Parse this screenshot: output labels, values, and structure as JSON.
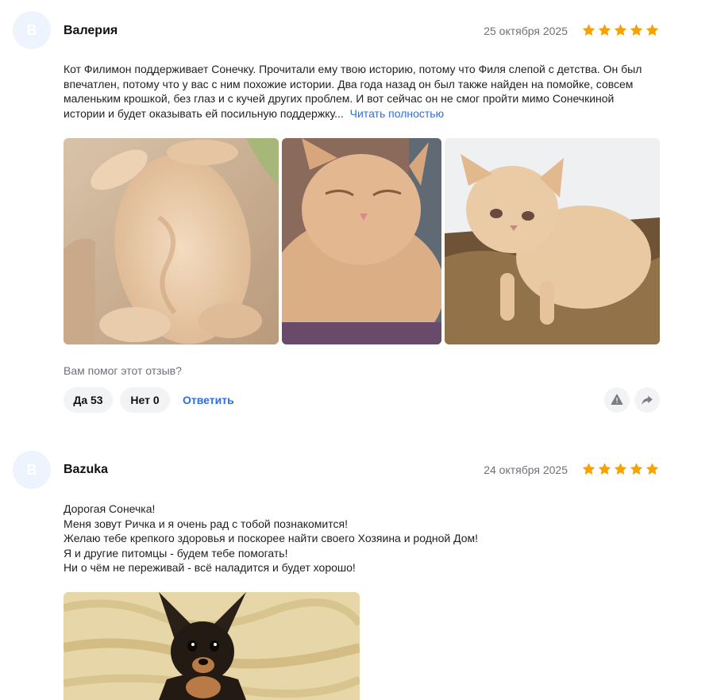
{
  "reviews": [
    {
      "avatar_letter": "B",
      "author": "Валерия",
      "date": "25 октября 2025",
      "rating": 5,
      "text": "Кот Филимон поддерживает Сонечку. Прочитали ему твою историю, потому что Филя слепой с детства. Он был впечатлен, потому что у вас с ним похожие истории. Два года назад он был также найден на помойке, совсем маленьким крошкой, без глаз и с кучей других проблем. И вот сейчас он не смог пройти мимо Сонечкиной истории и будет оказывать ей посильную поддержку...",
      "read_more": "Читать полностью",
      "helpful_question": "Вам помог этот отзыв?",
      "yes_label": "Да 53",
      "no_label": "Нет 0",
      "reply_label": "Ответить"
    },
    {
      "avatar_letter": "B",
      "author": "Bazuka",
      "date": "24 октября 2025",
      "rating": 5,
      "lines": [
        "Дорогая Сонечка!",
        "Меня зовут Ричка и я очень рад с тобой познакомится!",
        "Желаю тебе крепкого здоровья и поскорее найти своего Хозяина и родной Дом!",
        "Я и другие питомцы - будем тебе помогать!",
        "Ни о чём не переживай - всё наладится и будет хорошо!"
      ]
    }
  ],
  "colors": {
    "accent": "#2b6ee8",
    "star": "#f5a300",
    "muted": "#6e7178",
    "pill_bg": "#f2f3f5",
    "avatar_bg": "#eef4fd"
  },
  "icons": [
    "star-icon",
    "report-icon",
    "share-icon"
  ]
}
